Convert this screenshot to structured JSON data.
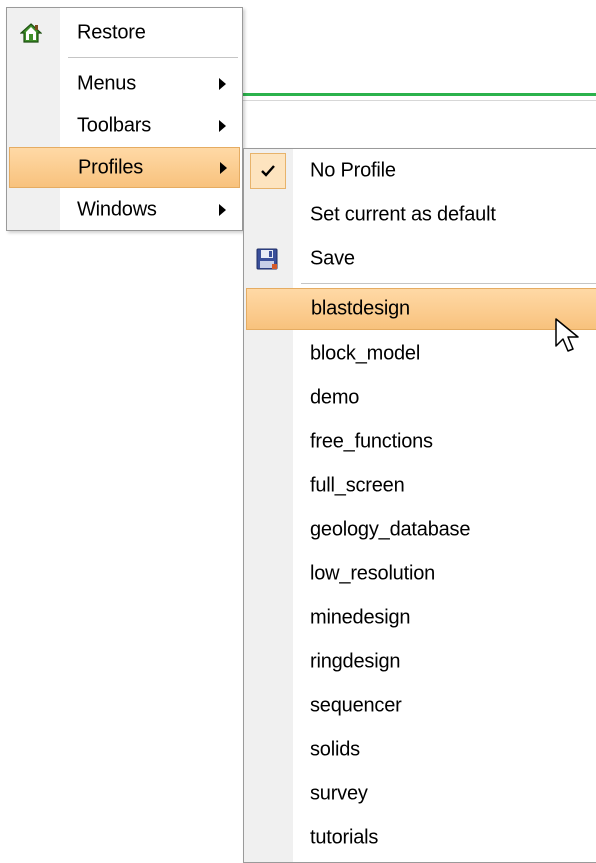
{
  "main_menu": {
    "items": [
      {
        "label": "Restore",
        "icon": "home-icon"
      },
      {
        "label": "Menus",
        "submenu": true
      },
      {
        "label": "Toolbars",
        "submenu": true
      },
      {
        "label": "Profiles",
        "submenu": true,
        "highlighted": true
      },
      {
        "label": "Windows",
        "submenu": true
      }
    ]
  },
  "profiles_menu": {
    "no_profile": {
      "label": "No Profile",
      "icon": "checkmark-icon"
    },
    "set_default": {
      "label": "Set current as default"
    },
    "save": {
      "label": "Save",
      "icon": "floppy-disk-icon"
    },
    "profiles": [
      "blastdesign",
      "block_model",
      "demo",
      "free_functions",
      "full_screen",
      "geology_database",
      "low_resolution",
      "minedesign",
      "ringdesign",
      "sequencer",
      "solids",
      "survey",
      "tutorials"
    ],
    "highlighted_profile": "blastdesign"
  },
  "colors": {
    "highlight_top": "#ffd9a6",
    "highlight_bottom": "#f8c27d",
    "highlight_border": "#e5ac62",
    "gutter": "#f0f0f0",
    "background_accent": "#2bb24c"
  }
}
